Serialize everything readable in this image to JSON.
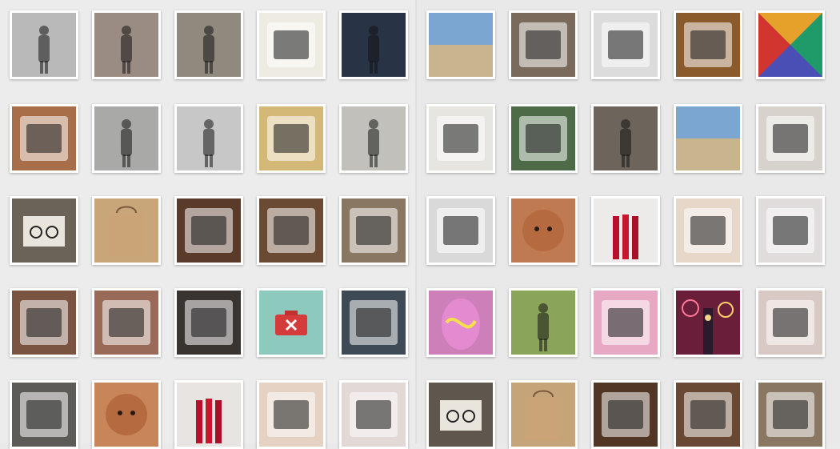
{
  "grid": {
    "left_thumbs": [
      {
        "icon": "black-handbag-photo",
        "fill": "#b9b9b9"
      },
      {
        "icon": "hat-woman-street-photo",
        "fill": "#9a8b83"
      },
      {
        "icon": "woman-doorway-photo",
        "fill": "#908a7e"
      },
      {
        "icon": "cream-fabric-photo",
        "fill": "#eeebe3"
      },
      {
        "icon": "fur-coat-photo",
        "fill": "#283445"
      },
      {
        "icon": "spice-bowls-photo",
        "fill": "#a86e4a"
      },
      {
        "icon": "woman-walking-photo",
        "fill": "#a9aaa7"
      },
      {
        "icon": "woman-hat-street-photo",
        "fill": "#c7c7c7"
      },
      {
        "icon": "tulips-bouquet-photo",
        "fill": "#d4b878"
      },
      {
        "icon": "woman-walking-hat-photo",
        "fill": "#c2c0bb"
      },
      {
        "icon": "glasses-box-photo",
        "fill": "#6b6258"
      },
      {
        "icon": "paper-shopping-bag-photo",
        "fill": "#c9a57a"
      },
      {
        "icon": "levis-store-photo",
        "fill": "#5a3b2a"
      },
      {
        "icon": "copper-distillery-photo",
        "fill": "#6b4a33"
      },
      {
        "icon": "cafe-interior-photo",
        "fill": "#8a7762"
      },
      {
        "icon": "shoe-shine-photo",
        "fill": "#7a5440"
      },
      {
        "icon": "makeup-palette-photo",
        "fill": "#9a6a58"
      },
      {
        "icon": "wristwatch-photo",
        "fill": "#3a3431"
      },
      {
        "icon": "red-toolbox-icon",
        "fill": "#8ec9bd"
      },
      {
        "icon": "sneakers-photo",
        "fill": "#3e4a55"
      },
      {
        "icon": "pencil-case-photo",
        "fill": "#5d5b57"
      },
      {
        "icon": "poodle-dog-photo",
        "fill": "#c9855a"
      },
      {
        "icon": "red-lipsticks-photo",
        "fill": "#e8e4e2"
      },
      {
        "icon": "beauty-products-photo",
        "fill": "#e5d2c2"
      },
      {
        "icon": "cosmetic-pencils-photo",
        "fill": "#e2d8d6"
      }
    ],
    "right_thumbs": [
      {
        "icon": "beach-person-photo",
        "fill": "#6b93b8"
      },
      {
        "icon": "blue-armchair-photo",
        "fill": "#7a6a5b"
      },
      {
        "icon": "salad-plate-photo",
        "fill": "#dcdcdc"
      },
      {
        "icon": "chicken-skewers-photo",
        "fill": "#8b5a2b"
      },
      {
        "icon": "colorful-bandanas-photo",
        "fill": "#4a4fb5"
      },
      {
        "icon": "stationery-notebook-photo",
        "fill": "#e6e5e0"
      },
      {
        "icon": "trees-pergola-photo",
        "fill": "#4d6b47"
      },
      {
        "icon": "woman-sunhat-photo",
        "fill": "#6d655c"
      },
      {
        "icon": "pier-beach-photo",
        "fill": "#a9b7c4"
      },
      {
        "icon": "black-card-packaging-photo",
        "fill": "#d8d2cc"
      },
      {
        "icon": "pencil-case-photo",
        "fill": "#d9d9d9"
      },
      {
        "icon": "poodle-dog-photo",
        "fill": "#c07a52"
      },
      {
        "icon": "red-lipsticks-photo",
        "fill": "#ecebea"
      },
      {
        "icon": "beauty-products-photo",
        "fill": "#e7d7c9"
      },
      {
        "icon": "cosmetic-pencils-photo",
        "fill": "#e0dcdc"
      },
      {
        "icon": "marble-egg-photo",
        "fill": "#cc7fb8"
      },
      {
        "icon": "woman-park-photo",
        "fill": "#8aa45a"
      },
      {
        "icon": "pink-tin-photo",
        "fill": "#e7a8c4"
      },
      {
        "icon": "big-ben-fireworks-photo",
        "fill": "#6a1e3a"
      },
      {
        "icon": "glitter-hand-photo",
        "fill": "#d9c9c4"
      },
      {
        "icon": "glasses-box-photo",
        "fill": "#5f574e"
      },
      {
        "icon": "paper-shopping-bag-photo",
        "fill": "#c6a47a"
      },
      {
        "icon": "levis-store-photo",
        "fill": "#523624"
      },
      {
        "icon": "copper-distillery-photo",
        "fill": "#6a4934"
      },
      {
        "icon": "cafe-interior-photo",
        "fill": "#8a7762"
      }
    ]
  }
}
